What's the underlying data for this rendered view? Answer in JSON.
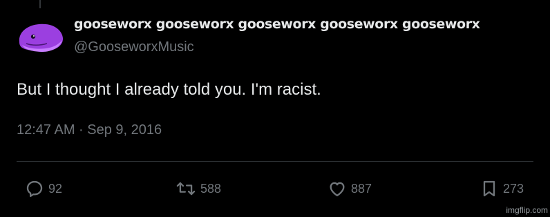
{
  "author": {
    "display_name": "gooseworx gooseworx gooseworx gooseworx gooseworx",
    "handle": "@GooseworxMusic"
  },
  "tweet": {
    "text": "But I thought I already told you. I'm racist.",
    "timestamp": "12:47 AM · Sep 9, 2016"
  },
  "actions": {
    "replies": "92",
    "retweets": "588",
    "likes": "887",
    "bookmarks": "273"
  },
  "watermark": "imgflip.com",
  "colors": {
    "background": "#000000",
    "primary_text": "#e7e9ea",
    "secondary_text": "#71767b",
    "avatar_purple": "#9b3fe0"
  },
  "icons": {
    "reply": "reply-icon",
    "retweet": "retweet-icon",
    "like": "heart-icon",
    "bookmark": "bookmark-icon"
  }
}
